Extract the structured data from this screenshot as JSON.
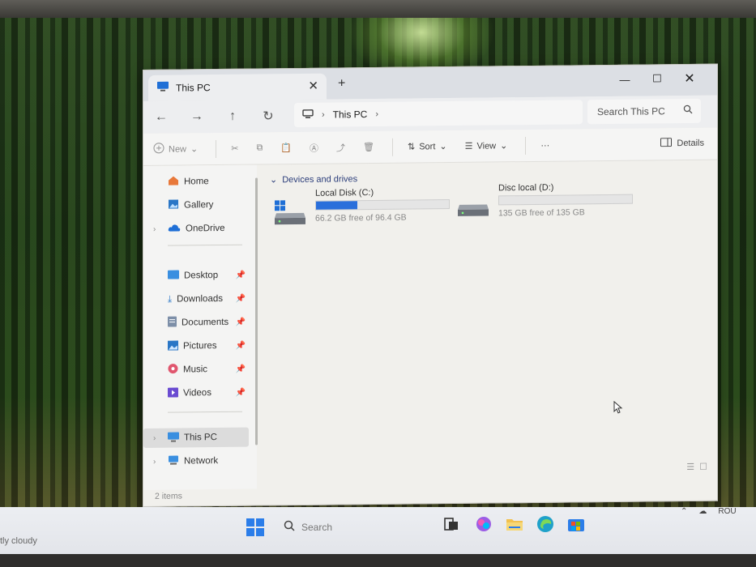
{
  "window": {
    "tab_title": "This PC",
    "tab_close": "✕",
    "new_tab": "+",
    "controls": {
      "minimize": "—",
      "maximize": "☐",
      "close": "✕"
    }
  },
  "nav": {
    "back": "←",
    "forward": "→",
    "up": "↑",
    "refresh": "↻",
    "breadcrumb": [
      "This PC"
    ],
    "search_placeholder": "Search This PC"
  },
  "toolbar": {
    "new_label": "New",
    "sort_label": "Sort",
    "view_label": "View",
    "more_label": "···",
    "details_label": "Details"
  },
  "sidebar": {
    "quick": [
      {
        "label": "Home",
        "icon": "home-icon"
      },
      {
        "label": "Gallery",
        "icon": "gallery-icon"
      },
      {
        "label": "OneDrive",
        "icon": "cloud-icon"
      }
    ],
    "pinned": [
      {
        "label": "Desktop",
        "icon": "desktop-icon"
      },
      {
        "label": "Downloads",
        "icon": "download-icon"
      },
      {
        "label": "Documents",
        "icon": "documents-icon"
      },
      {
        "label": "Pictures",
        "icon": "pictures-icon"
      },
      {
        "label": "Music",
        "icon": "music-icon"
      },
      {
        "label": "Videos",
        "icon": "videos-icon"
      }
    ],
    "devices": [
      {
        "label": "This PC",
        "icon": "computer-icon"
      },
      {
        "label": "Network",
        "icon": "network-icon"
      }
    ]
  },
  "content": {
    "group_header": "Devices and drives",
    "drives": [
      {
        "name": "Local Disk (C:)",
        "free_text": "66.2 GB free of 96.4 GB",
        "used_fraction": 0.313
      },
      {
        "name": "Disc local (D:)",
        "free_text": "135 GB free of 135 GB",
        "used_fraction": 0.0
      }
    ]
  },
  "status": {
    "items": "2 items"
  },
  "taskbar": {
    "weather": "tly cloudy",
    "search_placeholder": "Search",
    "language": "ROU"
  },
  "colors": {
    "accent": "#2a6fdb",
    "window_bg": "#f1f0ec"
  }
}
